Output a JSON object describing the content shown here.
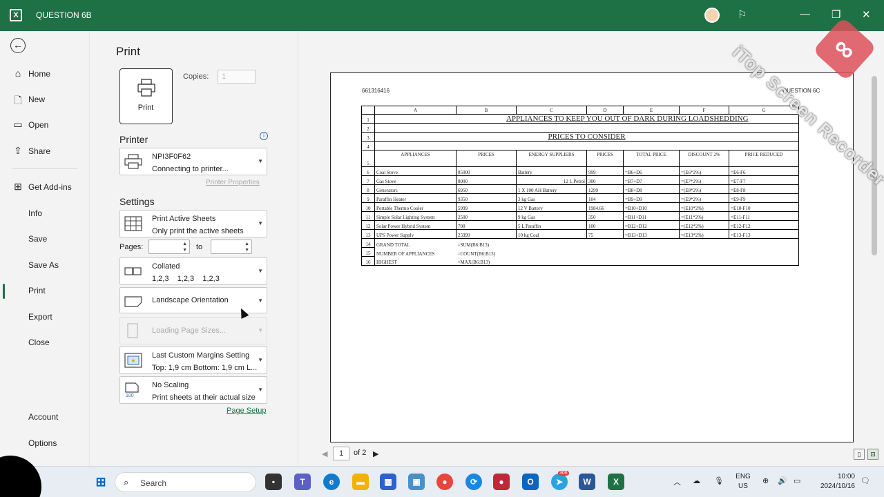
{
  "window": {
    "title": "QUESTION 6B",
    "app_icon": "excel-icon"
  },
  "watermark": "iTop Screen Recorder",
  "nav": {
    "back": "back-arrow-icon",
    "items": [
      {
        "label": "Home",
        "icon": "home-icon"
      },
      {
        "label": "New",
        "icon": "new-document-icon"
      },
      {
        "label": "Open",
        "icon": "open-folder-icon"
      },
      {
        "label": "Share",
        "icon": "share-icon"
      },
      {
        "label": "Get Add-ins",
        "icon": "add-ins-icon"
      },
      {
        "label": "Info",
        "icon": ""
      },
      {
        "label": "Save",
        "icon": ""
      },
      {
        "label": "Save As",
        "icon": ""
      },
      {
        "label": "Print",
        "icon": "",
        "active": true
      },
      {
        "label": "Export",
        "icon": ""
      },
      {
        "label": "Close",
        "icon": ""
      },
      {
        "label": "Account",
        "icon": ""
      },
      {
        "label": "Options",
        "icon": ""
      }
    ]
  },
  "print": {
    "heading": "Print",
    "button_label": "Print",
    "copies_label": "Copies:",
    "copies_value": "1",
    "printer_section": "Printer",
    "printer_name": "NPI3F0F62",
    "printer_status": "Connecting to printer...",
    "printer_properties": "Printer Properties",
    "settings_section": "Settings",
    "what_to_print": "Print Active Sheets",
    "what_to_print_sub": "Only print the active sheets",
    "pages_label": "Pages:",
    "to_label": "to",
    "collated": "Collated",
    "collated_sub": "1,2,3    1,2,3    1,2,3",
    "orientation": "Landscape Orientation",
    "page_size": "Loading Page Sizes...",
    "margins": "Last Custom Margins Setting",
    "margins_sub": "Top: 1,9 cm Bottom: 1,9 cm L...",
    "scaling": "No Scaling",
    "scaling_sub": "Print sheets at their actual size",
    "scaling_badge": "100",
    "page_setup": "Page Setup"
  },
  "preview": {
    "header_left": "661316416",
    "header_right": "QUESTION 6C",
    "col_letters": [
      "A",
      "B",
      "C",
      "D",
      "E",
      "F",
      "G"
    ],
    "row_numbers": [
      "1",
      "2",
      "3",
      "4",
      "5",
      "6",
      "7",
      "8",
      "9",
      "10",
      "11",
      "12",
      "13",
      "14",
      "15",
      "16"
    ],
    "title1": "APPLIANCES TO KEEP YOU OUT OF DARK DURING LOADSHEDDING",
    "title2": "PRICES TO CONSIDER",
    "headers": [
      "APPLIANCES",
      "PRICES",
      "ENERGY SUPPLIERS",
      "PRICES",
      "TOTAL PRICE",
      "DISCOUNT 2%",
      "PRICE REDUCED"
    ],
    "rows": [
      [
        "Coal Stove",
        "85000",
        "Battery",
        "999",
        "=B6+D6",
        "=(E6*2%)",
        "=E6-F6"
      ],
      [
        "Gas Stove",
        "8000",
        "12 L Petrol",
        "300",
        "=B7+D7",
        "=(E7*2%)",
        "=E7-F7"
      ],
      [
        "Generators",
        "6950",
        "1 X 100 AH Battery",
        "1299",
        "=B8+D8",
        "=(E8*2%)",
        "=E8-F8"
      ],
      [
        "Paraffin Heater",
        "9350",
        "3 kg Gas",
        "104",
        "=B9+D9",
        "=(E9*2%)",
        "=E9-F9"
      ],
      [
        "Portable Thermo Cooler",
        "5999",
        "12 V Battery",
        "1984.66",
        "=B10+D10",
        "=(E10*2%)",
        "=E10-F10"
      ],
      [
        "Simple Solar Lighting System",
        "2500",
        "9 kg Gas",
        "350",
        "=B11+D11",
        "=(E11*2%)",
        "=E11-F11"
      ],
      [
        "Solar Power Hybrid System",
        "700",
        "5 L Paraffin",
        "100",
        "=B12+D12",
        "=(E12*2%)",
        "=E12-F12"
      ],
      [
        "UPS Power Supply",
        "25999",
        "10 kg Coal",
        "75",
        "=B13+D13",
        "=(E13*2%)",
        "=E13-F13"
      ]
    ],
    "summary": [
      [
        "GRAND TOTAL",
        "=SUM(B6:B13)"
      ],
      [
        "NUMBER OF APPLIANCES",
        "=COUNT(B6:B13)"
      ],
      [
        "HIGHEST",
        "=MAX(B6:B13)"
      ]
    ],
    "page_num": "1",
    "page_of": "of 2"
  },
  "taskbar": {
    "search_placeholder": "Search",
    "lang1": "ENG",
    "lang2": "US",
    "time": "10:00",
    "date": "2024/10/16",
    "mail_badge": "306"
  }
}
